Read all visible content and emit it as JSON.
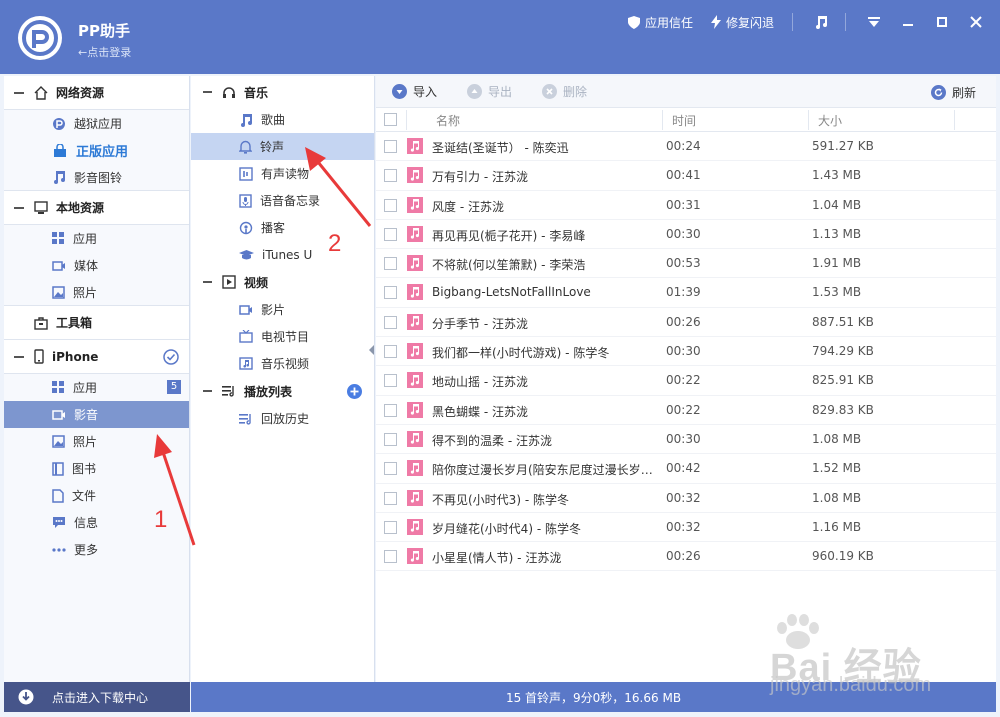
{
  "app": {
    "title": "PP助手",
    "login_hint": "←点击登录"
  },
  "titlebar": {
    "trust_label": "应用信任",
    "fix_label": "修复闪退"
  },
  "sidebar": {
    "sections": [
      {
        "label": "网络资源",
        "icon": "home-icon",
        "items": [
          {
            "label": "越狱应用",
            "icon": "pp-logo-icon"
          },
          {
            "label": "正版应用",
            "icon": "store-icon"
          },
          {
            "label": "影音图铃",
            "icon": "music-note-icon"
          }
        ]
      },
      {
        "label": "本地资源",
        "icon": "monitor-icon",
        "items": [
          {
            "label": "应用",
            "icon": "grid-icon"
          },
          {
            "label": "媒体",
            "icon": "video-icon"
          },
          {
            "label": "照片",
            "icon": "photo-icon"
          }
        ]
      },
      {
        "label": "工具箱",
        "icon": "toolbox-icon",
        "items": []
      },
      {
        "label": "iPhone",
        "icon": "phone-icon",
        "items": [
          {
            "label": "应用",
            "icon": "grid-icon",
            "badge": "5"
          },
          {
            "label": "影音",
            "icon": "video-icon"
          },
          {
            "label": "照片",
            "icon": "photo-icon"
          },
          {
            "label": "图书",
            "icon": "book-icon"
          },
          {
            "label": "文件",
            "icon": "file-icon"
          },
          {
            "label": "信息",
            "icon": "message-icon"
          },
          {
            "label": "更多",
            "icon": "more-icon"
          }
        ]
      }
    ],
    "bottom_label": "点击进入下载中心"
  },
  "categories": {
    "music": {
      "label": "音乐",
      "items": [
        "歌曲",
        "铃声",
        "有声读物",
        "语音备忘录",
        "播客",
        "iTunes U"
      ]
    },
    "video": {
      "label": "视频",
      "items": [
        "影片",
        "电视节目",
        "音乐视频"
      ]
    },
    "playlist": {
      "label": "播放列表",
      "items": [
        "回放历史"
      ]
    }
  },
  "toolbar": {
    "import_label": "导入",
    "export_label": "导出",
    "delete_label": "删除",
    "refresh_label": "刷新"
  },
  "table": {
    "headers": {
      "name": "名称",
      "time": "时间",
      "size": "大小"
    },
    "rows": [
      {
        "name": "圣诞结(圣诞节） - 陈奕迅",
        "time": "00:24",
        "size": "591.27 KB"
      },
      {
        "name": "万有引力 - 汪苏泷",
        "time": "00:41",
        "size": "1.43 MB"
      },
      {
        "name": "风度 - 汪苏泷",
        "time": "00:31",
        "size": "1.04 MB"
      },
      {
        "name": "再见再见(栀子花开) - 李易峰",
        "time": "00:30",
        "size": "1.13 MB"
      },
      {
        "name": "不将就(何以笙箫默) - 李荣浩",
        "time": "00:53",
        "size": "1.91 MB"
      },
      {
        "name": "Bigbang-LetsNotFallInLove",
        "time": "01:39",
        "size": "1.53 MB"
      },
      {
        "name": "分手季节 - 汪苏泷",
        "time": "00:26",
        "size": "887.51 KB"
      },
      {
        "name": "我们都一样(小时代游戏) - 陈学冬",
        "time": "00:30",
        "size": "794.29 KB"
      },
      {
        "name": "地动山摇 - 汪苏泷",
        "time": "00:22",
        "size": "825.91 KB"
      },
      {
        "name": "黑色蝴蝶 - 汪苏泷",
        "time": "00:22",
        "size": "829.83 KB"
      },
      {
        "name": "得不到的温柔 - 汪苏泷",
        "time": "00:30",
        "size": "1.08 MB"
      },
      {
        "name": "陪你度过漫长岁月(陪安东尼度过漫长岁月...",
        "time": "00:42",
        "size": "1.52 MB"
      },
      {
        "name": "不再见(小时代3) - 陈学冬",
        "time": "00:32",
        "size": "1.08 MB"
      },
      {
        "name": "岁月缝花(小时代4) - 陈学冬",
        "time": "00:32",
        "size": "1.16 MB"
      },
      {
        "name": "小星星(情人节) - 汪苏泷",
        "time": "00:26",
        "size": "960.19 KB"
      }
    ]
  },
  "status": {
    "text": "15 首铃声，9分0秒，16.66 MB"
  },
  "annotations": {
    "step1": "1",
    "step2": "2"
  },
  "watermark": {
    "line1": "Bai 经验",
    "line2": "jingyan.baidu.com"
  },
  "colors": {
    "brand": "#5a78c8",
    "selected": "#7d96cf",
    "accent_red": "#e83a3a",
    "note_pink": "#ef7aa6"
  }
}
